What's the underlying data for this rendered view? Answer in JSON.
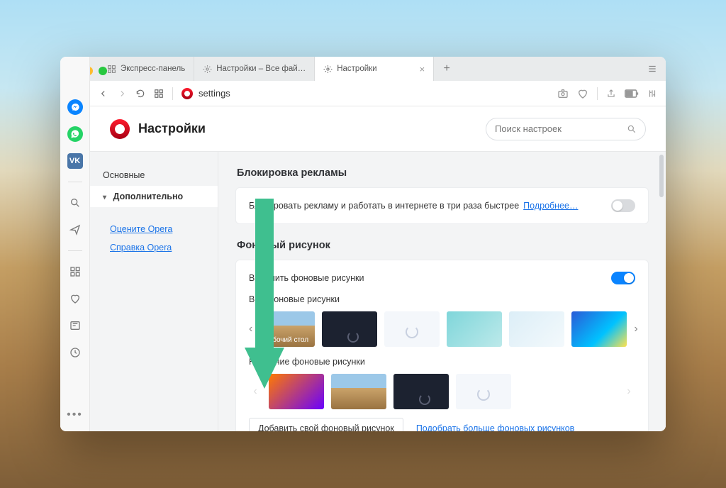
{
  "tabs": [
    {
      "label": "Экспресс-панель",
      "icon": "speed-dial"
    },
    {
      "label": "Настройки – Все файлы coo",
      "icon": "gear"
    },
    {
      "label": "Настройки",
      "icon": "gear",
      "active": true
    }
  ],
  "addressbar": {
    "text": "settings"
  },
  "header": {
    "title": "Настройки",
    "search_placeholder": "Поиск настроек"
  },
  "leftnav": {
    "primary": "Основные",
    "secondary": "Дополнительно",
    "rate_link": "Оцените Opera",
    "help_link": "Справка Opera"
  },
  "sections": {
    "adblock": {
      "title": "Блокировка рекламы",
      "row_text": "Блокировать рекламу и работать в интернете в три раза быстрее",
      "learn_more": "Подробнее…",
      "enabled": false
    },
    "wallpaper": {
      "title": "Фоновый рисунок",
      "enable_row": "Включить фоновые рисунки",
      "enabled": true,
      "all_label": "Все фоновые рисунки",
      "recent_label": "Недавние фоновые рисунки",
      "desktop_thumb_label": "Рабочий стол",
      "add_btn": "Добавить свой фоновый рисунок",
      "more_link": "Подобрать больше фоновых рисунков"
    }
  },
  "colors": {
    "arrow": "#3fbf8f"
  }
}
